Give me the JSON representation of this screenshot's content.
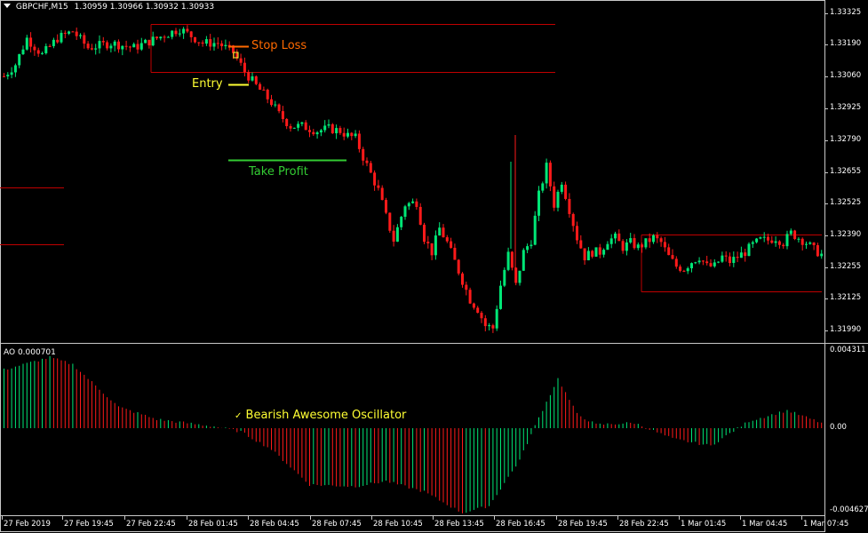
{
  "header": {
    "symbol_label": "GBPCHF,M15",
    "ohlc": "1.30959 1.30966 1.30932 1.30933"
  },
  "ao_panel": {
    "label": "AO 0.000701"
  },
  "annotations": {
    "stop_loss": "Stop Loss",
    "entry": "Entry",
    "take_profit": "Take Profit",
    "bearish_ao": "Bearish Awesome Oscillator"
  },
  "colors": {
    "background": "#000000",
    "bull": "#00e676",
    "bear": "#ff1a1a",
    "stop_loss": "#ff6a00",
    "entry": "#ffff33",
    "take_profit": "#33cc33",
    "level_lines": "#c00000"
  },
  "chart_data": [
    {
      "type": "candlestick",
      "title": "GBPCHF,M15",
      "y_ticks": [
        "1.33325",
        "1.33190",
        "1.33060",
        "1.32925",
        "1.32790",
        "1.32655",
        "1.32525",
        "1.32390",
        "1.32255",
        "1.32125",
        "1.31990"
      ],
      "ylim": [
        1.3192,
        1.3338
      ],
      "x_ticks": [
        "27 Feb 2019",
        "27 Feb 19:45",
        "27 Feb 22:45",
        "28 Feb 01:45",
        "28 Feb 04:45",
        "28 Feb 07:45",
        "28 Feb 10:45",
        "28 Feb 13:45",
        "28 Feb 16:45",
        "28 Feb 19:45",
        "28 Feb 22:45",
        "1 Mar 01:45",
        "1 Mar 04:45",
        "1 Mar 07:45"
      ],
      "trade_levels": {
        "stop_loss": 1.3317,
        "entry": 1.3302,
        "take_profit": 1.3273
      },
      "close_path": [
        [
          0,
          1.3306
        ],
        [
          3,
          1.3311
        ],
        [
          6,
          1.3322
        ],
        [
          10,
          1.3315
        ],
        [
          14,
          1.3322
        ],
        [
          18,
          1.3325
        ],
        [
          22,
          1.3318
        ],
        [
          28,
          1.332
        ],
        [
          34,
          1.3318
        ],
        [
          40,
          1.3322
        ],
        [
          46,
          1.3326
        ],
        [
          52,
          1.332
        ],
        [
          56,
          1.332
        ],
        [
          60,
          1.3316
        ],
        [
          63,
          1.3308
        ],
        [
          66,
          1.3302
        ],
        [
          70,
          1.3295
        ],
        [
          72,
          1.329
        ],
        [
          75,
          1.3285
        ],
        [
          78,
          1.3285
        ],
        [
          82,
          1.3283
        ],
        [
          85,
          1.3284
        ],
        [
          88,
          1.3283
        ],
        [
          90,
          1.3281
        ],
        [
          92,
          1.328
        ],
        [
          94,
          1.3272
        ],
        [
          96,
          1.3265
        ],
        [
          98,
          1.3258
        ],
        [
          100,
          1.3247
        ],
        [
          102,
          1.3237
        ],
        [
          105,
          1.3252
        ],
        [
          108,
          1.3253
        ],
        [
          110,
          1.3238
        ],
        [
          112,
          1.3232
        ],
        [
          114,
          1.3242
        ],
        [
          116,
          1.3236
        ],
        [
          118,
          1.3228
        ],
        [
          120,
          1.322
        ],
        [
          122,
          1.3212
        ],
        [
          124,
          1.3208
        ],
        [
          126,
          1.3201
        ],
        [
          128,
          1.32
        ],
        [
          130,
          1.3218
        ],
        [
          132,
          1.3231
        ],
        [
          134,
          1.3218
        ],
        [
          136,
          1.3232
        ],
        [
          138,
          1.3237
        ],
        [
          140,
          1.3256
        ],
        [
          142,
          1.3268
        ],
        [
          144,
          1.3252
        ],
        [
          146,
          1.3262
        ],
        [
          148,
          1.325
        ],
        [
          150,
          1.3238
        ],
        [
          152,
          1.323
        ],
        [
          154,
          1.3232
        ],
        [
          156,
          1.3232
        ],
        [
          158,
          1.3237
        ],
        [
          160,
          1.3238
        ],
        [
          162,
          1.3234
        ],
        [
          164,
          1.3236
        ],
        [
          166,
          1.3234
        ],
        [
          168,
          1.3236
        ],
        [
          170,
          1.3238
        ],
        [
          172,
          1.3236
        ],
        [
          174,
          1.323
        ],
        [
          176,
          1.3226
        ],
        [
          178,
          1.3225
        ],
        [
          180,
          1.3228
        ],
        [
          182,
          1.323
        ],
        [
          184,
          1.3226
        ],
        [
          186,
          1.3226
        ],
        [
          188,
          1.323
        ],
        [
          190,
          1.3228
        ],
        [
          192,
          1.323
        ],
        [
          194,
          1.3232
        ],
        [
          196,
          1.3235
        ],
        [
          198,
          1.3237
        ],
        [
          200,
          1.3237
        ],
        [
          202,
          1.3238
        ],
        [
          204,
          1.3236
        ],
        [
          206,
          1.324
        ],
        [
          208,
          1.3238
        ],
        [
          210,
          1.3236
        ],
        [
          212,
          1.3233
        ],
        [
          214,
          1.3231
        ]
      ]
    },
    {
      "type": "bar",
      "title": "AO 0.000701",
      "y_ticks": [
        "0.004311",
        "0.00",
        "-0.004627"
      ],
      "ylim": [
        -0.004627,
        0.004311
      ],
      "segments": [
        [
          0,
          0.0033
        ],
        [
          12,
          0.004
        ],
        [
          18,
          0.0036
        ],
        [
          30,
          0.0012
        ],
        [
          40,
          0.0005
        ],
        [
          55,
          0.0001
        ],
        [
          62,
          -0.0002
        ],
        [
          70,
          -0.0012
        ],
        [
          80,
          -0.0032
        ],
        [
          92,
          -0.0033
        ],
        [
          100,
          -0.003
        ],
        [
          110,
          -0.0036
        ],
        [
          120,
          -0.0048
        ],
        [
          127,
          -0.0044
        ],
        [
          135,
          -0.0018
        ],
        [
          140,
          0.0006
        ],
        [
          145,
          0.0028
        ],
        [
          150,
          0.0008
        ],
        [
          155,
          0.0002
        ],
        [
          165,
          0.0003
        ],
        [
          175,
          -0.0006
        ],
        [
          185,
          -0.001
        ],
        [
          195,
          0.0004
        ],
        [
          205,
          0.001
        ],
        [
          214,
          0.0003
        ]
      ]
    }
  ]
}
